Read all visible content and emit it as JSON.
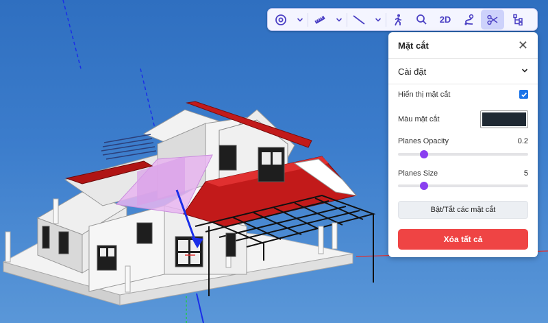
{
  "toolbar": {
    "mode_2d_label": "2D",
    "icons": [
      "target-icon",
      "chevron-down-icon",
      "ruler-icon",
      "chevron-down-icon",
      "line-icon",
      "chevron-down-icon",
      "walk-icon",
      "search-icon",
      "path-icon",
      "scissors-icon",
      "tree-icon"
    ],
    "active_tool": "section"
  },
  "panel": {
    "title": "Mặt cắt",
    "section_title": "Cài đặt",
    "show_section_label": "Hiển thị mặt cắt",
    "show_section_checked": true,
    "section_color_label": "Màu mặt cắt",
    "section_color": "#1f2933",
    "planes_opacity_label": "Planes Opacity",
    "planes_opacity_value": "0.2",
    "planes_opacity_fraction": 0.2,
    "planes_size_label": "Planes Size",
    "planes_size_value": "5",
    "planes_size_fraction": 0.2,
    "toggle_button_label": "Bật/Tắt các mặt cắt",
    "clear_button_label": "Xóa tất cả"
  },
  "colors": {
    "accent": "#4b40c4",
    "slider_thumb": "#8a3ff0",
    "danger": "#ef4444",
    "checkbox": "#1a73e8",
    "roof_red": "#b81818",
    "section_plane": "#e7b5f0"
  }
}
